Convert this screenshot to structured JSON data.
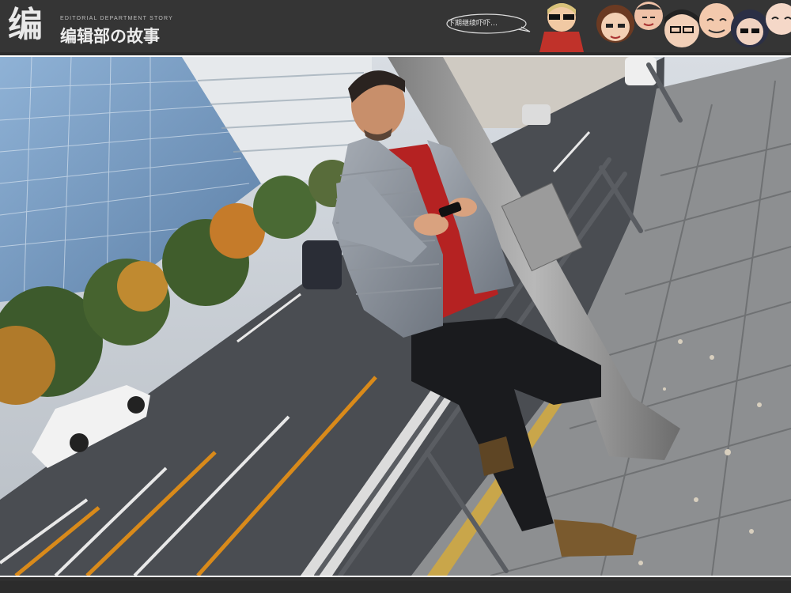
{
  "header": {
    "logo_mark": "编",
    "logo_en": "EDITORIAL DEPARTMENT STORY",
    "logo_cn": "编辑部の故事",
    "speech": "下期继续吓吓…"
  },
  "colors": {
    "header_bg": "#353535",
    "frame": "#ffffff",
    "road_line": "#d98a1a"
  },
  "photo": {
    "subject": "man-leaning-on-pole-with-phone"
  }
}
